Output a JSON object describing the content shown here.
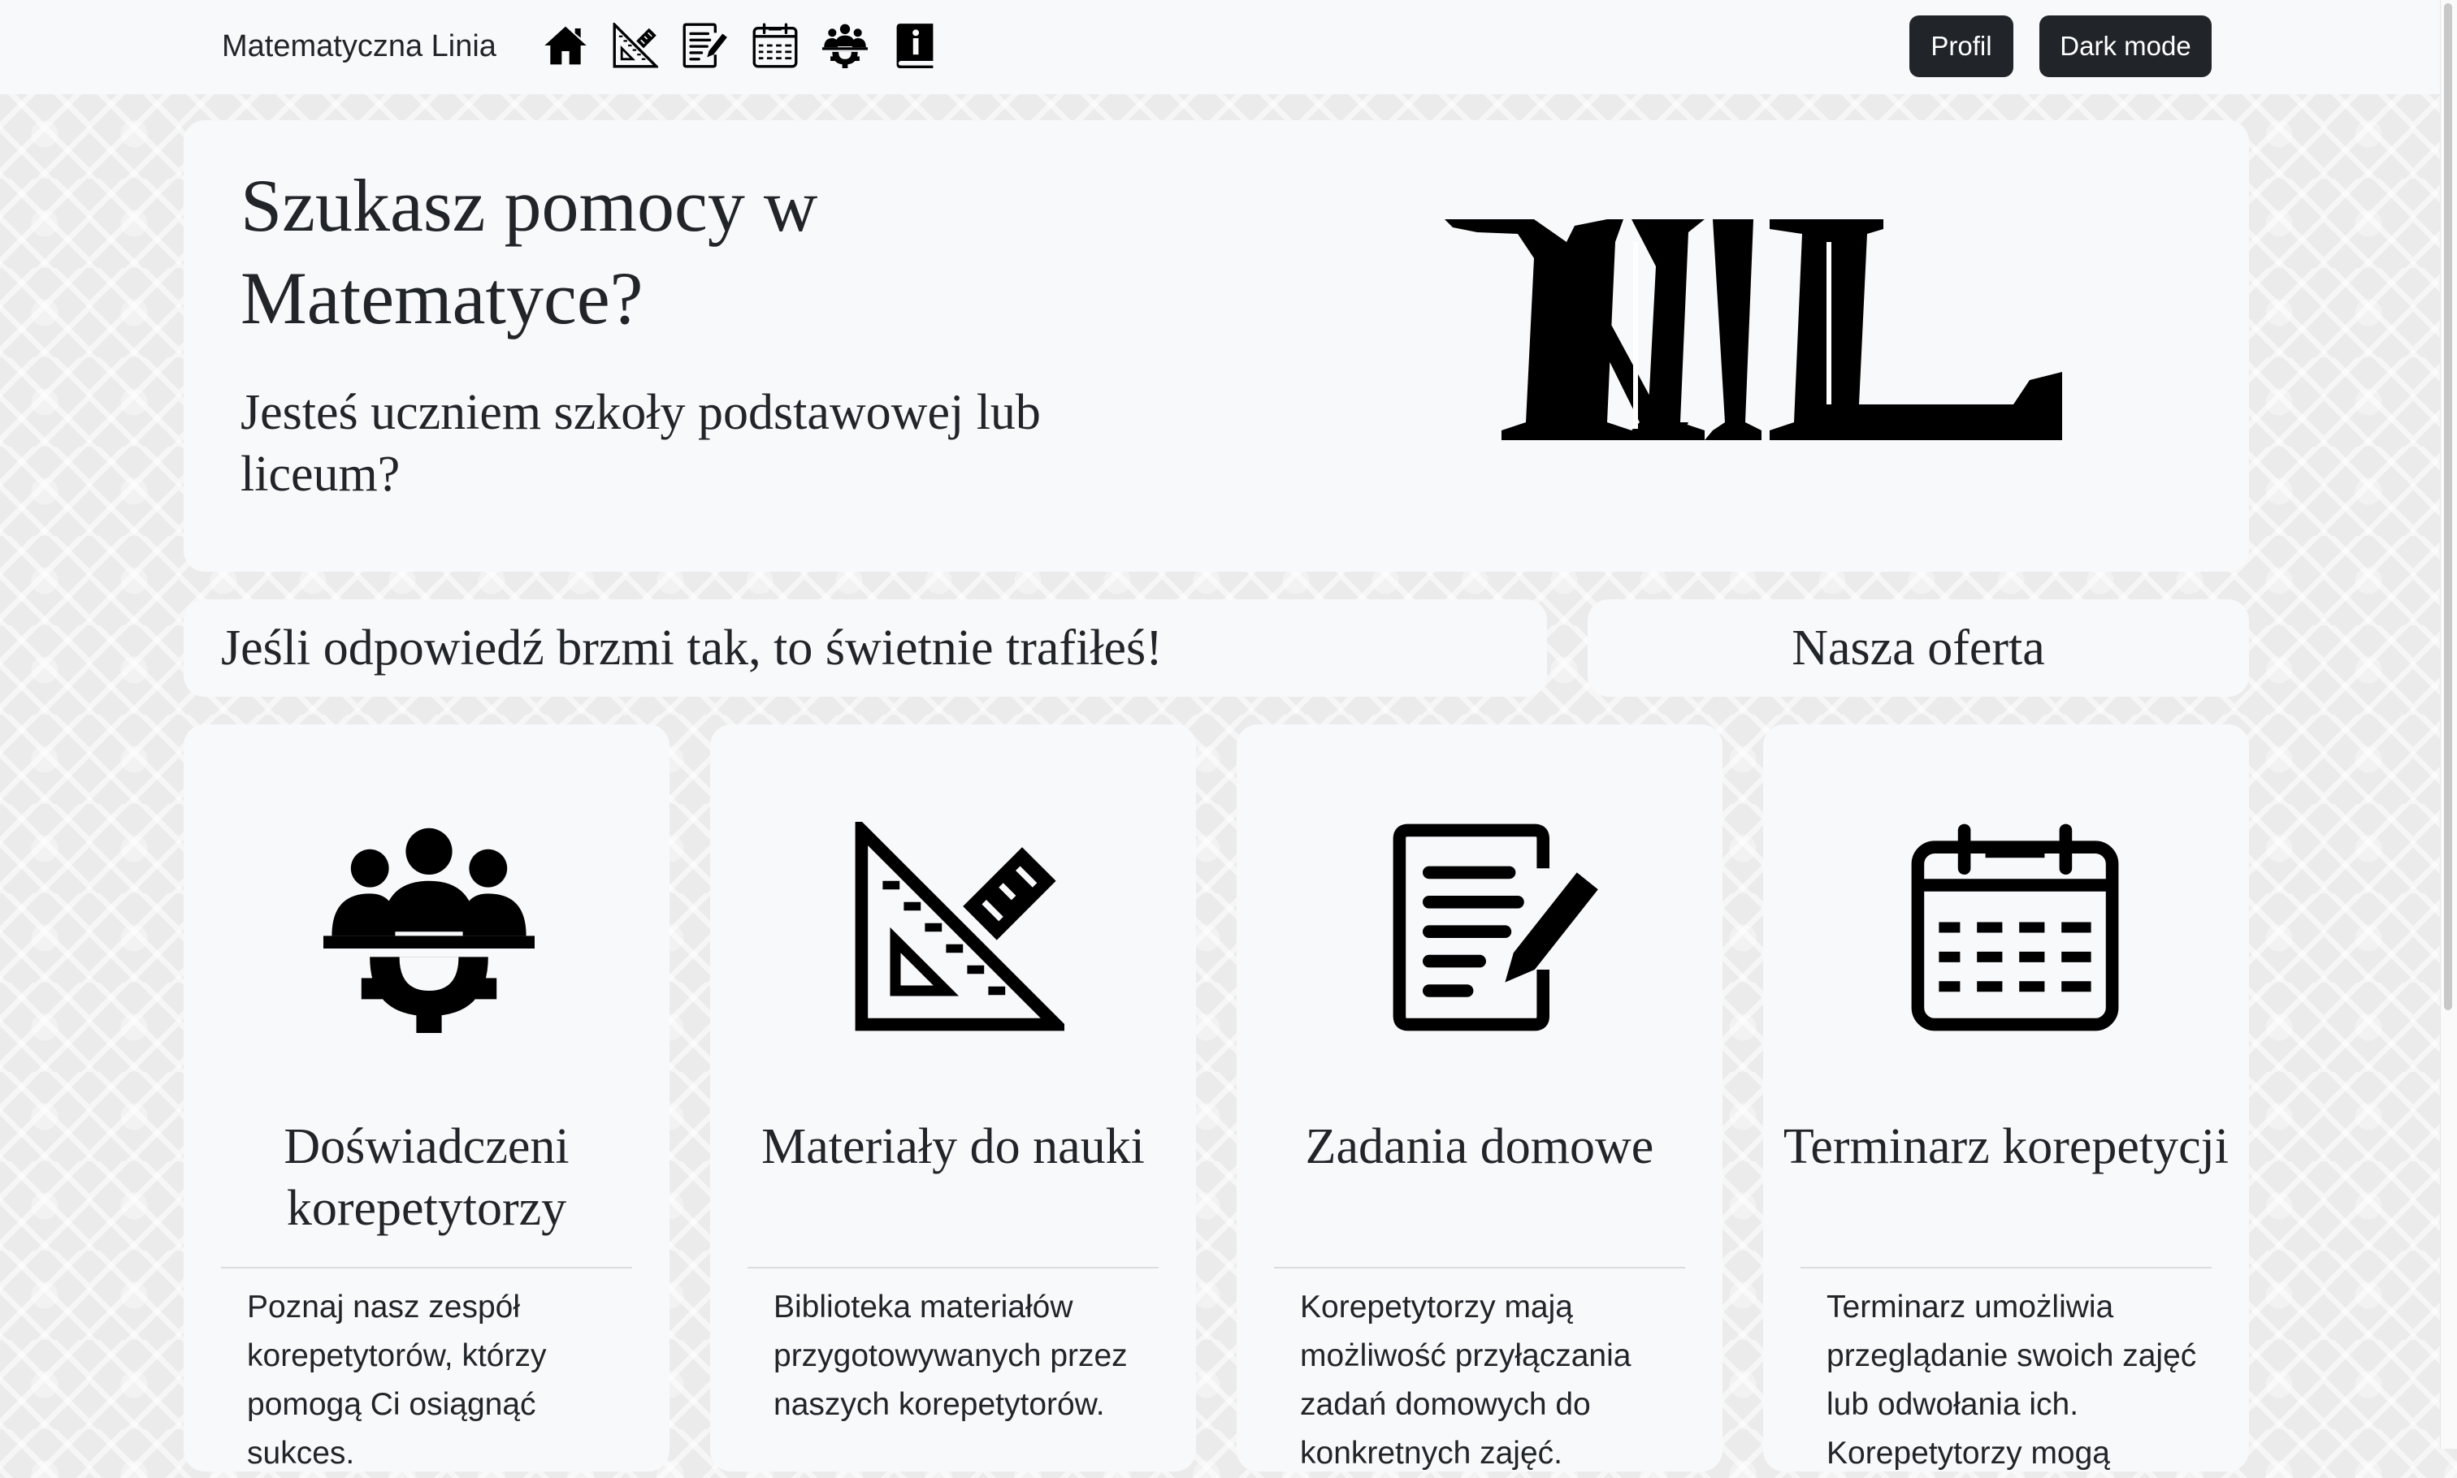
{
  "navbar": {
    "brand": "Matematyczna Linia",
    "icons": [
      "home-icon",
      "ruler-icon",
      "homework-icon",
      "calendar-icon",
      "tutors-icon",
      "info-book-icon"
    ],
    "profile_label": "Profil",
    "dark_mode_label": "Dark mode"
  },
  "hero": {
    "title": "Szukasz pomocy w Matematyce?",
    "subtitle": "Jesteś uczniem szkoły podstawowej lub liceum?",
    "logo_text": "ML"
  },
  "strip": {
    "left": "Jeśli odpowiedź brzmi tak, to świetnie trafiłeś!",
    "right": "Nasza oferta"
  },
  "features": [
    {
      "icon": "tutors-icon",
      "title": "Doświadczeni korepetytorzy",
      "text": "Poznaj nasz zespół korepetytorów, którzy pomogą Ci osiągnąć sukces."
    },
    {
      "icon": "ruler-icon",
      "title": "Materiały do nauki",
      "text": "Biblioteka materiałów przygotowywanych przez naszych korepetytorów."
    },
    {
      "icon": "homework-icon",
      "title": "Zadania domowe",
      "text": "Korepetytorzy mają możliwość przyłączania zadań domowych do konkretnych zajęć."
    },
    {
      "icon": "calendar-icon",
      "title": "Terminarz korepetycji",
      "text": "Terminarz umożliwia przeglądanie swoich zajęć lub odwołania ich. Korepetytorzy mogą"
    }
  ],
  "colors": {
    "navbar_bg": "#f8f9fa",
    "button_bg": "#212529",
    "text": "#212529"
  }
}
